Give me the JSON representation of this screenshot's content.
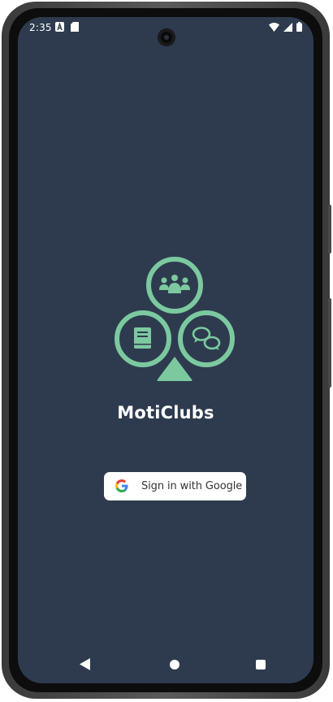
{
  "status_bar": {
    "time": "2:35",
    "icons": [
      "font-a-icon",
      "sd-card-icon",
      "wifi-icon",
      "signal-icon",
      "battery-icon"
    ]
  },
  "app": {
    "title": "MotiClubs",
    "logo_icons": [
      "group-icon",
      "book-icon",
      "chat-icon"
    ],
    "accent_color": "#7cc9a0",
    "background_color": "#2e3b4e"
  },
  "sign_in": {
    "label": "Sign in with Google",
    "icon": "google-icon"
  },
  "nav_bar": {
    "buttons": [
      "back-icon",
      "home-icon",
      "recents-icon"
    ]
  }
}
